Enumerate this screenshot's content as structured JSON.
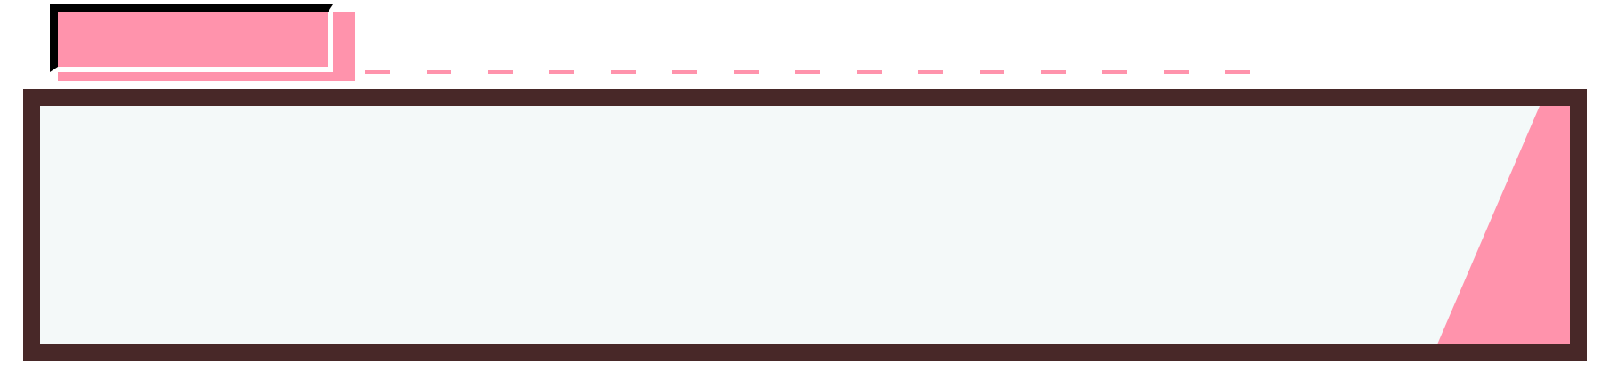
{
  "colors": {
    "accent_pink": "#ff93ac",
    "frame_brown": "#482828",
    "panel_fill": "#f4f9f9",
    "outline_black": "#000000",
    "background": "#ffffff"
  },
  "decor": {
    "header_block": "pink-block-icon",
    "connector": "dashed-line-icon",
    "panel_corner": "pink-wedge-icon"
  }
}
